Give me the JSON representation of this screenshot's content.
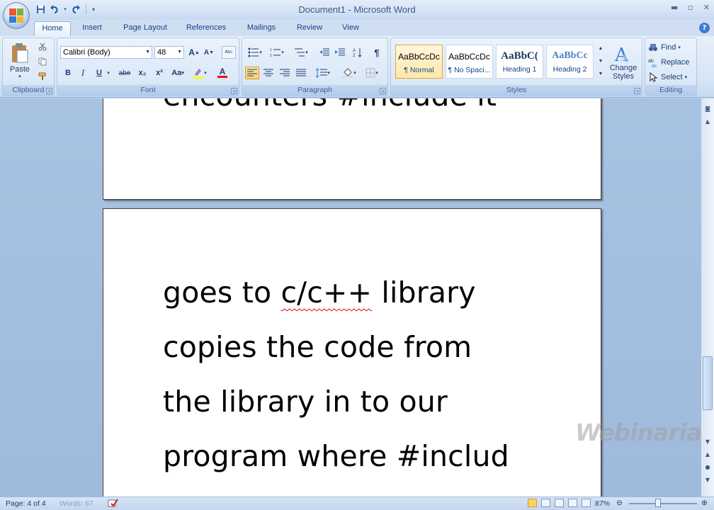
{
  "window": {
    "title": "Document1 - Microsoft Word"
  },
  "quick_access": {
    "save": "save-icon",
    "undo": "undo-icon",
    "redo": "redo-icon"
  },
  "tabs": [
    "Home",
    "Insert",
    "Page Layout",
    "References",
    "Mailings",
    "Review",
    "View"
  ],
  "ribbon": {
    "clipboard": {
      "label": "Clipboard",
      "paste": "Paste"
    },
    "font": {
      "label": "Font",
      "family": "Calibri (Body)",
      "size": "48",
      "bold": "B",
      "italic": "I",
      "underline": "U",
      "strike": "abe",
      "sub": "x₂",
      "sup": "x²",
      "case": "Aa",
      "grow": "A",
      "shrink": "A",
      "font_color": "A"
    },
    "paragraph": {
      "label": "Paragraph",
      "pilcrow": "¶"
    },
    "styles": {
      "label": "Styles",
      "items": [
        {
          "sample": "AaBbCcDc",
          "name": "¶ Normal"
        },
        {
          "sample": "AaBbCcDc",
          "name": "¶ No Spaci..."
        },
        {
          "sample": "AaBbC(",
          "name": "Heading 1"
        },
        {
          "sample": "AaBbCc",
          "name": "Heading 2"
        }
      ],
      "change": "Change Styles"
    },
    "editing": {
      "label": "Editing",
      "find": "Find",
      "replace": "Replace",
      "select": "Select"
    }
  },
  "document": {
    "page1_tail": "encounters #include it",
    "page2_lines": [
      "goes to ",
      "c/c++",
      " library",
      "copies the code from",
      "the library in to our",
      "program where #includ"
    ]
  },
  "status": {
    "page": "Page: 4 of 4",
    "words": "Words: 67",
    "zoom": "87%"
  },
  "watermark": "Webinaria",
  "colors": {
    "accent": "#15428b",
    "ribbon": "#dbe8f7",
    "docbg": "#a8c2e2"
  }
}
